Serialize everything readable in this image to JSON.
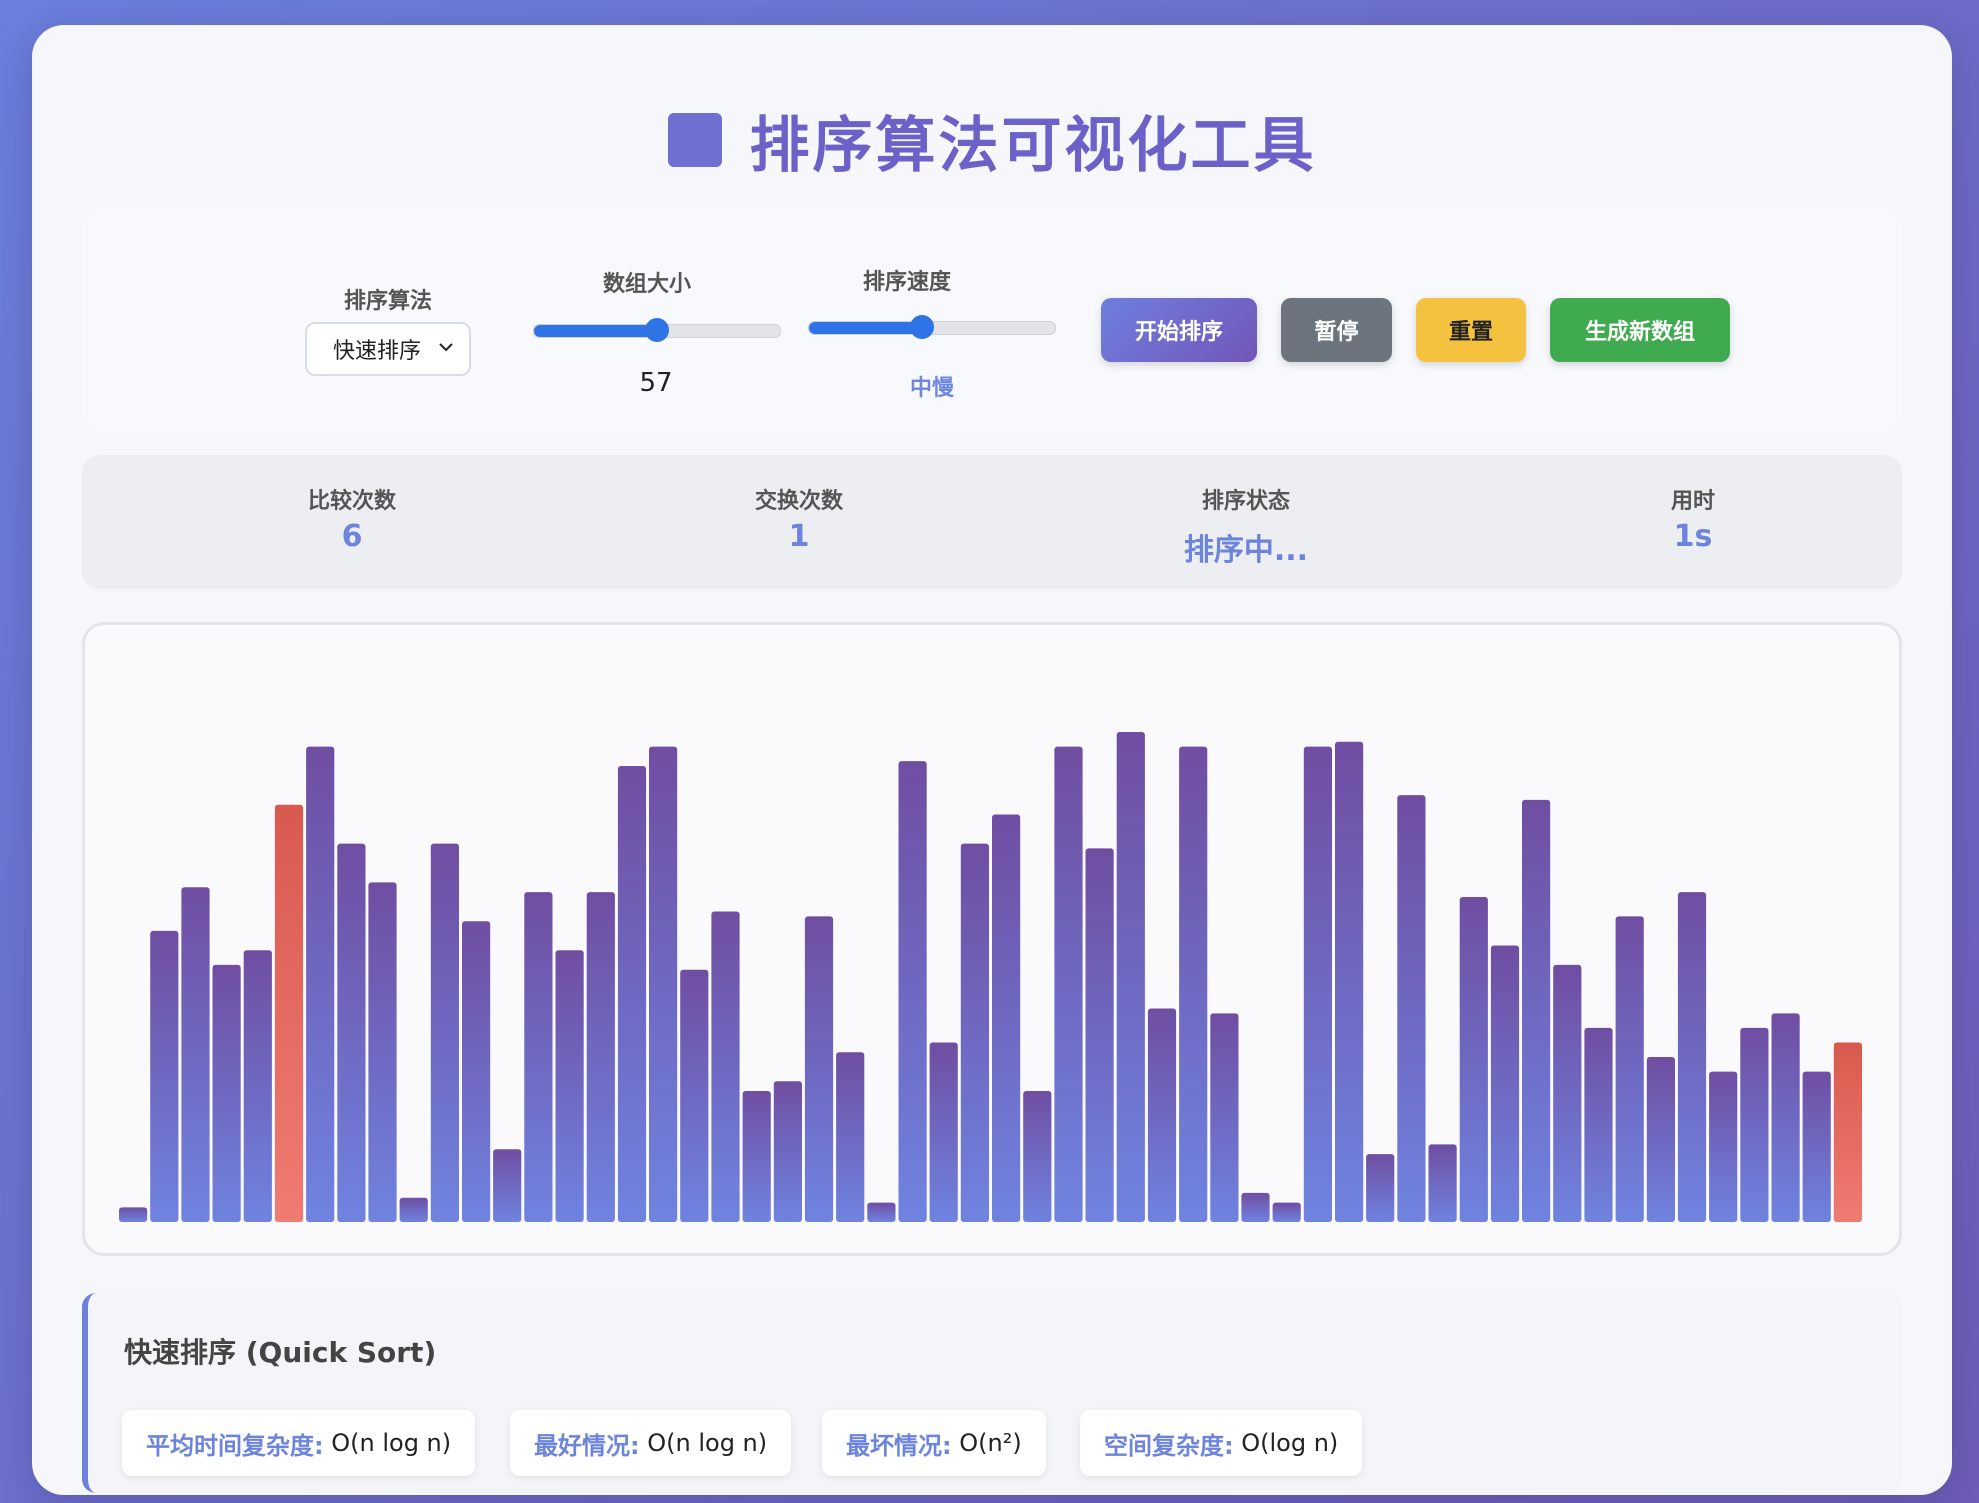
{
  "header": {
    "title": "排序算法可视化工具"
  },
  "controls": {
    "algorithm_label": "排序算法",
    "algorithm_value": "快速排序",
    "size_label": "数组大小",
    "size_value": "57",
    "size_fraction": 0.5,
    "speed_label": "排序速度",
    "speed_value": "中慢",
    "speed_fraction": 0.46,
    "buttons": {
      "start": "开始排序",
      "pause": "暂停",
      "reset": "重置",
      "generate": "生成新数组"
    }
  },
  "stats": {
    "comparisons_label": "比较次数",
    "comparisons": "6",
    "swaps_label": "交换次数",
    "swaps": "1",
    "status_label": "排序状态",
    "status": "排序中...",
    "time_label": "用时",
    "time": "1s"
  },
  "colors": {
    "bar_top": "#6f4ea2",
    "bar_bottom": "#6f83e0",
    "compare_top": "#d85a4e",
    "compare_bottom": "#f07b72",
    "accent": "#6d84dc"
  },
  "chart_data": {
    "type": "bar",
    "values": [
      3,
      60,
      69,
      53,
      56,
      86,
      98,
      78,
      70,
      5,
      78,
      62,
      15,
      68,
      56,
      68,
      94,
      98,
      52,
      64,
      27,
      29,
      63,
      35,
      4,
      95,
      37,
      78,
      84,
      27,
      98,
      77,
      101,
      44,
      98,
      43,
      6,
      4,
      98,
      99,
      14,
      88,
      16,
      67,
      57,
      87,
      53,
      40,
      63,
      34,
      68,
      31,
      40,
      43,
      31,
      37
    ],
    "highlighted_indices": [
      5,
      55
    ],
    "ylim": [
      0,
      101
    ]
  },
  "info": {
    "title": "快速排序 (Quick Sort)",
    "avg_label": "平均时间复杂度:",
    "avg_value": "O(n log n)",
    "best_label": "最好情况:",
    "best_value": "O(n log n)",
    "worst_label": "最坏情况:",
    "worst_value": "O(n²)",
    "space_label": "空间复杂度:",
    "space_value": "O(log n)"
  }
}
